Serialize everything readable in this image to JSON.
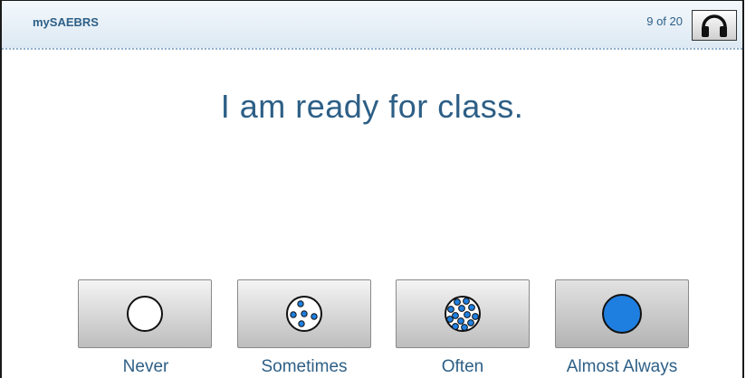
{
  "header": {
    "app_name": "mySAEBRS",
    "progress_text": "9 of 20",
    "audio_icon": "headphones-icon"
  },
  "question": {
    "text": "I am ready for class."
  },
  "choices": [
    {
      "label": "Never",
      "icon": "empty-circle-icon"
    },
    {
      "label": "Sometimes",
      "icon": "few-dots-circle-icon"
    },
    {
      "label": "Often",
      "icon": "many-dots-circle-icon"
    },
    {
      "label": "Almost Always",
      "icon": "filled-circle-icon"
    }
  ],
  "colors": {
    "accent": "#1f7fe0",
    "text": "#2d5f86"
  }
}
